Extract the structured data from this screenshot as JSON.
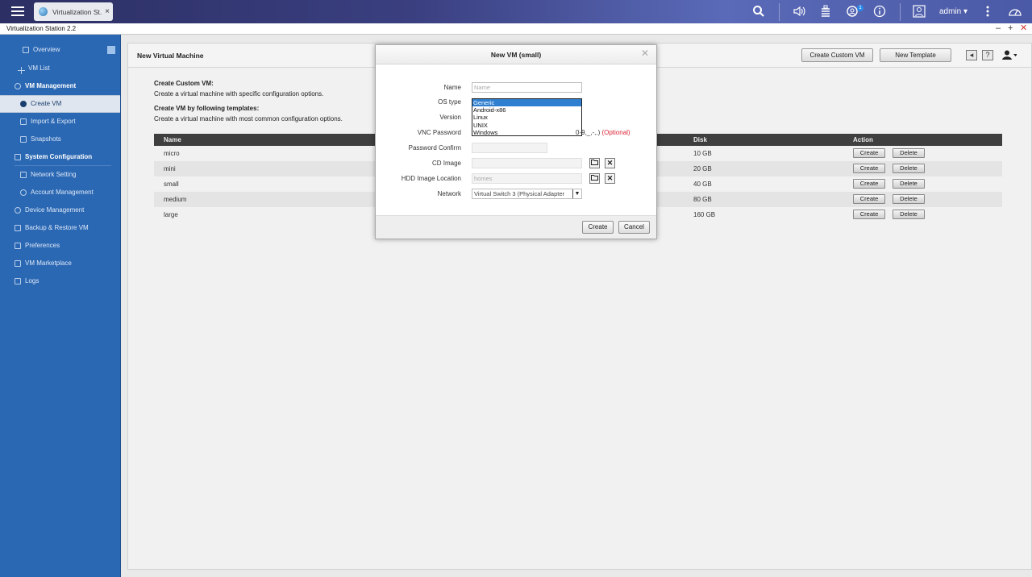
{
  "app_tab": {
    "label": "Virtualization St...",
    "close": "×"
  },
  "topbar": {
    "user": "admin ▾",
    "notify_count": "1"
  },
  "window": {
    "title": "Virtualization Station 2.2",
    "minimize": "–",
    "maximize": "+",
    "close": "✕"
  },
  "sidebar": {
    "items": [
      {
        "label": "Overview"
      },
      {
        "label": "VM List"
      },
      {
        "label": "VM Management"
      },
      {
        "label": "Create VM"
      },
      {
        "label": "Import & Export"
      },
      {
        "label": "Snapshots"
      },
      {
        "label": "System Configuration"
      },
      {
        "label": "Network Setting"
      },
      {
        "label": "Account Management"
      },
      {
        "label": "Device Management"
      },
      {
        "label": "Backup & Restore VM"
      },
      {
        "label": "Preferences"
      },
      {
        "label": "VM Marketplace"
      },
      {
        "label": "Logs"
      }
    ]
  },
  "main": {
    "title": "New Virtual Machine",
    "create_custom_vm_btn": "Create Custom VM",
    "new_template_btn": "New Template",
    "help": "?",
    "section1_title": "Create Custom VM:",
    "section1_desc": "Create a virtual machine with specific configuration options.",
    "section2_title": "Create VM by following templates:",
    "section2_desc": "Create a virtual machine with most common configuration options.",
    "table": {
      "headers": {
        "name": "Name",
        "disk": "Disk",
        "action": "Action"
      },
      "rows": [
        {
          "name": "micro",
          "disk": "10 GB"
        },
        {
          "name": "mini",
          "disk": "20 GB"
        },
        {
          "name": "small",
          "disk": "40 GB"
        },
        {
          "name": "medium",
          "disk": "80 GB"
        },
        {
          "name": "large",
          "disk": "160 GB"
        }
      ],
      "create_label": "Create",
      "delete_label": "Delete"
    }
  },
  "modal": {
    "title": "New VM (small)",
    "close": "✕",
    "labels": {
      "name": "Name",
      "os_type": "OS type",
      "version": "Version",
      "vnc_password": "VNC Password",
      "password_confirm": "Password Confirm",
      "cd_image": "CD Image",
      "hdd_image_location": "HDD Image Location",
      "network": "Network"
    },
    "name_placeholder": "Name",
    "os_options": [
      "Generic",
      "Android-x86",
      "Linux",
      "UNIX",
      "Windows"
    ],
    "vnc_hint": "0-9,_,-,.)",
    "vnc_optional": "(Optional)",
    "hdd_location_value": "homes",
    "network_value": "Virtual Switch 3 (Physical Adapter",
    "create_btn": "Create",
    "cancel_btn": "Cancel"
  }
}
